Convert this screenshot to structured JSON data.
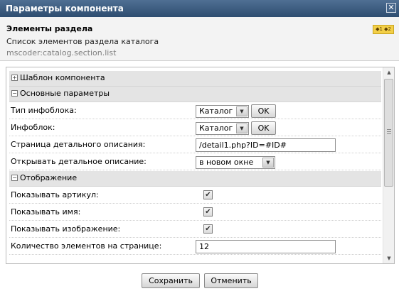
{
  "window": {
    "title": "Параметры компонента",
    "close_glyph": "✕"
  },
  "component": {
    "name": "Элементы раздела",
    "description": "Список элементов раздела каталога",
    "code": "mscoder:catalog.section.list",
    "badge": "◆1 ◆2"
  },
  "sections": {
    "template": {
      "label": "Шаблон компонента",
      "toggle": "+"
    },
    "basic": {
      "label": "Основные параметры",
      "toggle": "−"
    },
    "display": {
      "label": "Отображение",
      "toggle": "−"
    }
  },
  "fields": {
    "iblock_type": {
      "label": "Тип инфоблока:",
      "value": "Каталог",
      "ok": "OK"
    },
    "iblock": {
      "label": "Инфоблок:",
      "value": "Каталог",
      "ok": "OK"
    },
    "detail_url": {
      "label": "Страница детального описания:",
      "value": "/detail1.php?ID=#ID#"
    },
    "open_detail": {
      "label": "Открывать детальное описание:",
      "value": "в новом окне"
    },
    "show_article": {
      "label": "Показывать артикул:",
      "checked": true
    },
    "show_name": {
      "label": "Показывать имя:",
      "checked": true
    },
    "show_image": {
      "label": "Показывать изображение:",
      "checked": true
    },
    "page_count": {
      "label": "Количество элементов на странице:",
      "value": "12"
    }
  },
  "glyphs": {
    "dropdown": "▼",
    "check": "✔",
    "scroll_up": "▲",
    "scroll_down": "▼"
  },
  "footer": {
    "save": "Сохранить",
    "cancel": "Отменить"
  },
  "colors": {
    "titlebar": "#3a5a7e",
    "section_bg": "#e4e4e4",
    "badge": "#f3cf47"
  }
}
